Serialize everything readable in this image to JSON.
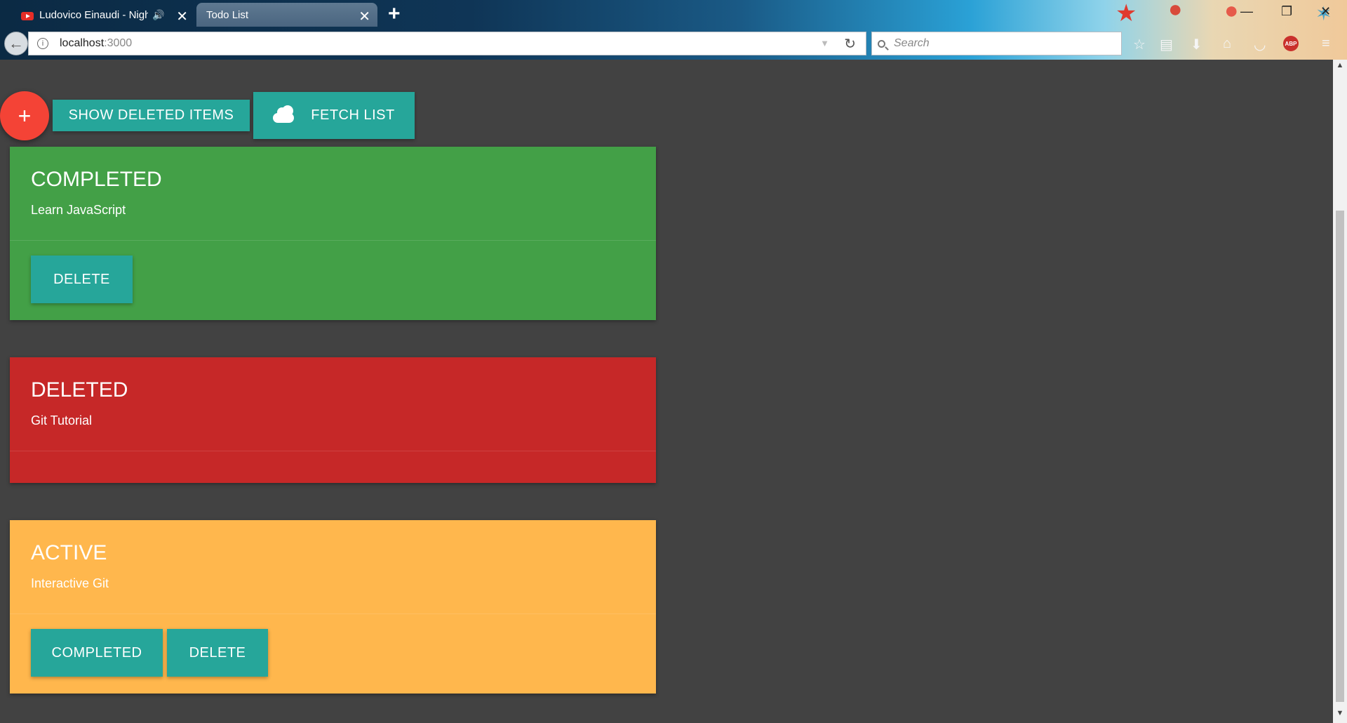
{
  "browser": {
    "tabs": [
      {
        "title": "Ludovico Einaudi - Night"
      },
      {
        "title": "Todo List"
      }
    ],
    "url_host": "localhost",
    "url_port": ":3000",
    "search_placeholder": "Search"
  },
  "toolbar": {
    "add_label": "+",
    "show_deleted_label": "SHOW DELETED ITEMS",
    "fetch_label": "FETCH LIST"
  },
  "cards": [
    {
      "status": "COMPLETED",
      "text": "Learn JavaScript",
      "color": "#43a047",
      "actions": [
        "DELETE"
      ]
    },
    {
      "status": "DELETED",
      "text": "Git Tutorial",
      "color": "#c62828",
      "actions": []
    },
    {
      "status": "ACTIVE",
      "text": "Interactive Git",
      "color": "#ffb74d",
      "actions": [
        "COMPLETED",
        "DELETE"
      ]
    }
  ],
  "colors": {
    "background": "#424242",
    "accent_button": "#26a69a",
    "fab": "#f44336"
  }
}
